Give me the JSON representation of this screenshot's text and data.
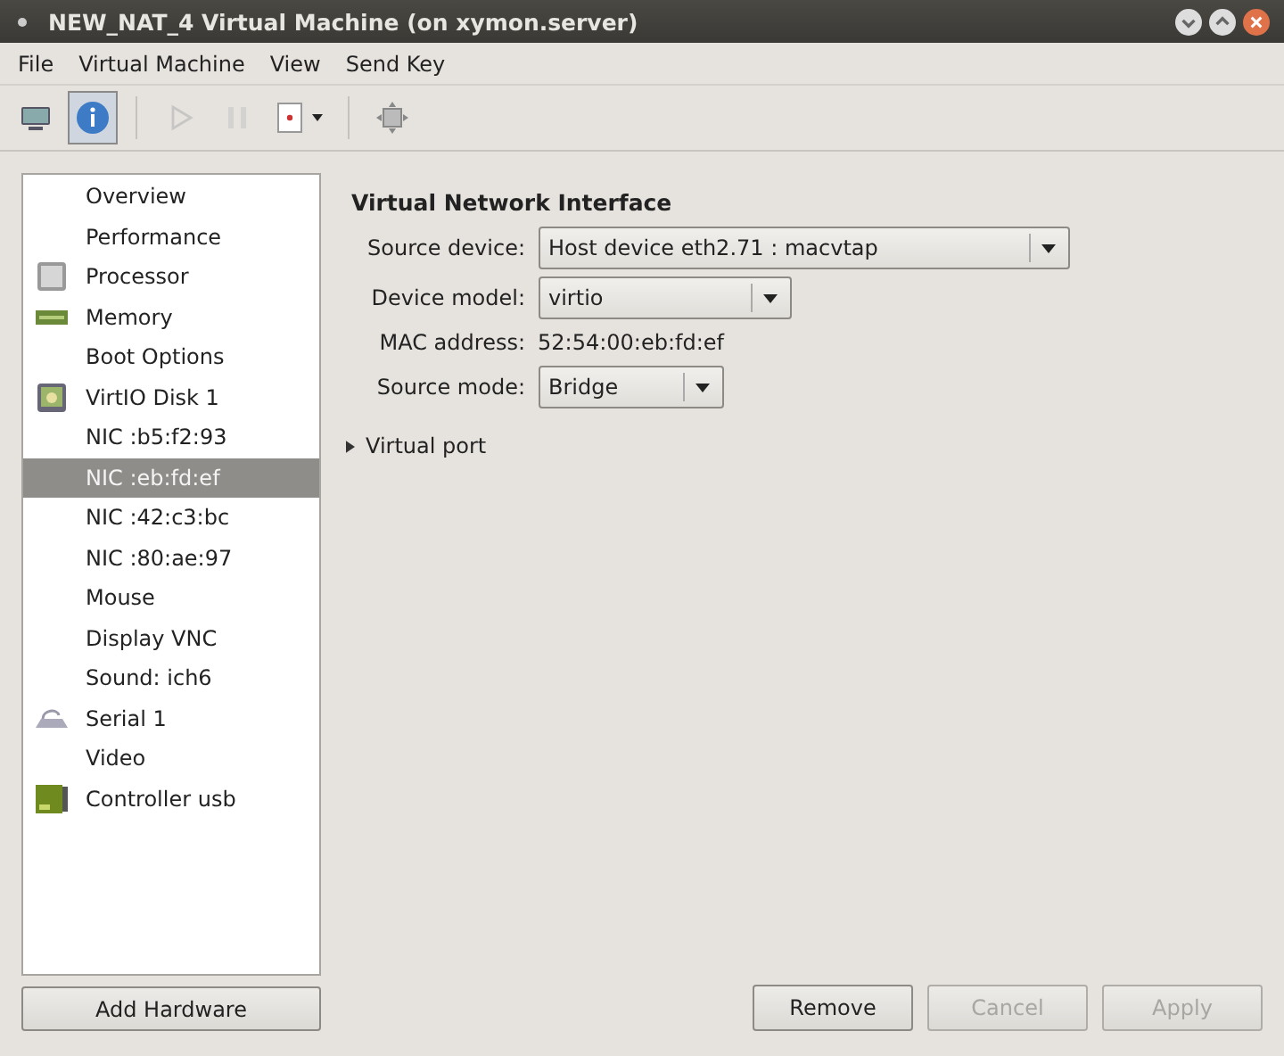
{
  "window": {
    "title": "NEW_NAT_4 Virtual Machine (on xymon.server)"
  },
  "menu": [
    "File",
    "Virtual Machine",
    "View",
    "Send Key"
  ],
  "toolbar": [
    {
      "kind": "console",
      "selected": false,
      "disabled": false
    },
    {
      "kind": "info",
      "selected": true,
      "disabled": false
    },
    {
      "kind": "play",
      "selected": false,
      "disabled": true
    },
    {
      "kind": "pause",
      "selected": false,
      "disabled": true
    },
    {
      "kind": "shutdown",
      "selected": false,
      "disabled": false
    },
    {
      "kind": "fullscreen",
      "selected": false,
      "disabled": false
    }
  ],
  "sidebar": {
    "items": [
      {
        "label": "Overview",
        "kind": "plain",
        "selected": false
      },
      {
        "label": "Performance",
        "kind": "plain",
        "selected": false
      },
      {
        "label": "Processor",
        "kind": "chip",
        "selected": false
      },
      {
        "label": "Memory",
        "kind": "memory",
        "selected": false
      },
      {
        "label": "Boot Options",
        "kind": "plain",
        "selected": false
      },
      {
        "label": "VirtIO Disk 1",
        "kind": "disk",
        "selected": false
      },
      {
        "label": "NIC :b5:f2:93",
        "kind": "plain",
        "selected": false
      },
      {
        "label": "NIC :eb:fd:ef",
        "kind": "plain",
        "selected": true
      },
      {
        "label": "NIC :42:c3:bc",
        "kind": "plain",
        "selected": false
      },
      {
        "label": "NIC :80:ae:97",
        "kind": "plain",
        "selected": false
      },
      {
        "label": "Mouse",
        "kind": "plain",
        "selected": false
      },
      {
        "label": "Display VNC",
        "kind": "plain",
        "selected": false
      },
      {
        "label": "Sound: ich6",
        "kind": "plain",
        "selected": false
      },
      {
        "label": "Serial 1",
        "kind": "serial",
        "selected": false
      },
      {
        "label": "Video",
        "kind": "plain",
        "selected": false
      },
      {
        "label": "Controller usb",
        "kind": "card",
        "selected": false
      }
    ],
    "add_button": "Add Hardware"
  },
  "details": {
    "heading": "Virtual Network Interface",
    "fields": [
      {
        "label": "Source device:",
        "kind": "dropdown",
        "value": "Host device eth2.71 : macvtap"
      },
      {
        "label": "Device model:",
        "kind": "dropdown",
        "value": "virtio"
      },
      {
        "label": "MAC address:",
        "kind": "text",
        "value": "52:54:00:eb:fd:ef"
      },
      {
        "label": "Source mode:",
        "kind": "dropdown",
        "value": "Bridge"
      }
    ],
    "expander": {
      "label": "Virtual port",
      "expanded": false
    }
  },
  "buttons": [
    {
      "label": "Remove",
      "disabled": false
    },
    {
      "label": "Cancel",
      "disabled": true
    },
    {
      "label": "Apply",
      "disabled": true
    }
  ]
}
